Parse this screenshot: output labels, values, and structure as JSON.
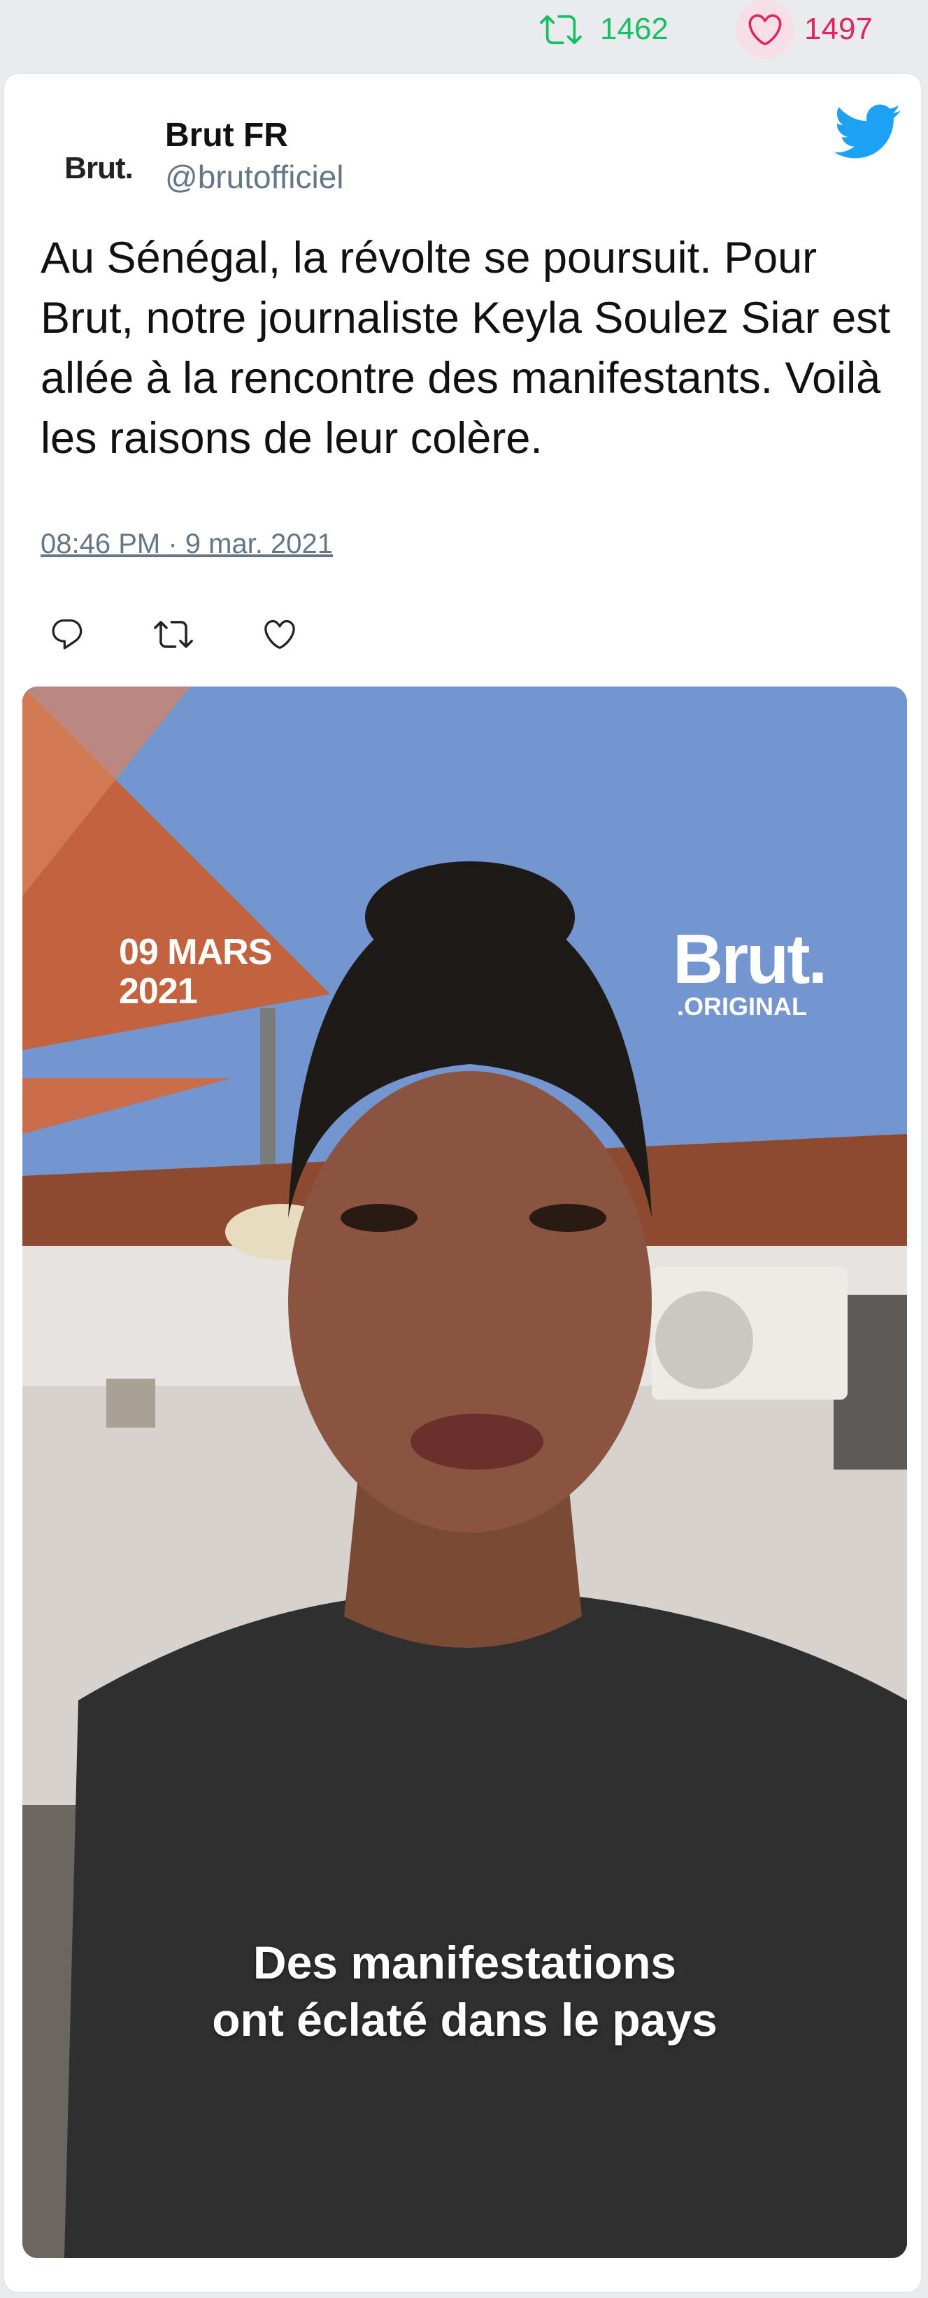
{
  "stats": {
    "retweet_count": "1462",
    "like_count": "1497",
    "retweet_icon": "retweet-icon",
    "like_icon": "heart-icon"
  },
  "tweet": {
    "avatar_text": "Brut.",
    "author_name": "Brut FR",
    "author_handle": "@brutofficiel",
    "brand_logo": "twitter-bird-icon",
    "text": "Au Sénégal, la révolte se poursuit. Pour Brut, notre journaliste Keyla Soulez Siar est allée à la rencontre des manifestants. Voilà les raisons de leur colère.",
    "timestamp": "08:46 PM · 9 mar. 2021",
    "actions": [
      "reply-icon",
      "retweet-icon",
      "like-icon"
    ]
  },
  "media": {
    "overlay_date_line1": "09 MARS",
    "overlay_date_line2": "2021",
    "overlay_brand_main": "Brut.",
    "overlay_brand_sub": ".ORIGINAL",
    "caption_line1": "Des manifestations",
    "caption_line2": "ont éclaté dans le pays"
  },
  "colors": {
    "retweet_green": "#17bf63",
    "like_pink": "#e0245e",
    "twitter_blue": "#1da1f2",
    "muted_text": "#657786"
  }
}
